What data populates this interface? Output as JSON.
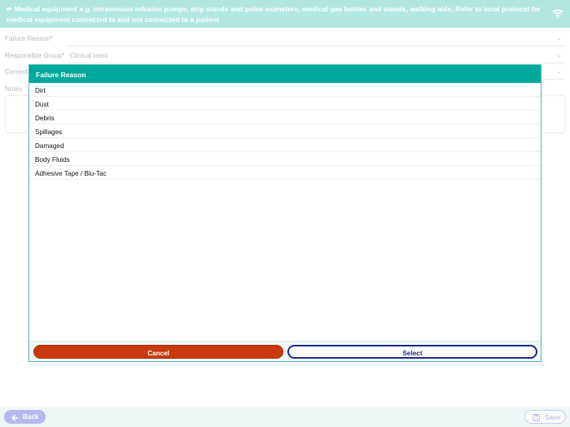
{
  "banner": {
    "text": "Medical equipment e.g. intravenous infusion pumps, drip stands and pulse oximeters, medical gas bottles and stands, walking aids. Refer to local protocol for medical equipment connected to and not connected to a patient.",
    "icon": "wifi-icon"
  },
  "form": {
    "failure_reason_label": "Failure Reason*",
    "failure_reason_value": "",
    "responsible_group_label": "Responsible Group*",
    "responsible_group_value": "Clinical team",
    "corrective_label": "Correcti",
    "notes_label": "Notes"
  },
  "modal": {
    "title": "Failure Reason",
    "options": [
      "Dirt",
      "Dust",
      "Debris",
      "Spillages",
      "Damaged",
      "Body Fluids",
      "Adhesive Tape / Blu-Tac"
    ],
    "cancel_label": "Cancel",
    "select_label": "Select"
  },
  "bottom": {
    "back_label": "Back",
    "save_label": "Save"
  },
  "colors": {
    "banner": "#b2e6e1",
    "modal_header": "#00a99d",
    "cancel": "#c93a0f",
    "select_border": "#1d2a8a"
  }
}
